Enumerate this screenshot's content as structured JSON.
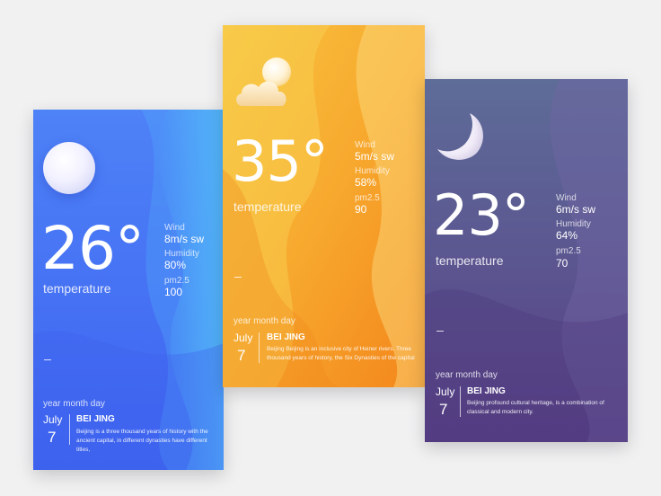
{
  "cards": [
    {
      "id": "blue",
      "colors": {
        "top": "#4f7df6",
        "bottom": "#3f5ef0",
        "accent": "#55c3f8"
      },
      "icon": "sun-icon",
      "temperature": "26°",
      "temperature_label": "temperature",
      "wind_label": "Wind",
      "wind_value": "8m/s sw",
      "humidity_label": "Humidity",
      "humidity_value": "80%",
      "pm_label": "pm2.5",
      "pm_value": "100",
      "date_label": "year month day",
      "month": "July",
      "day": "7",
      "city": "BEI JING",
      "description": "Beijing is a three thousand years of history with the ancient capital, in different dynasties have different titles,"
    },
    {
      "id": "orange",
      "colors": {
        "top": "#f7c13e",
        "bottom": "#f48a1e",
        "accent": "#fde38a"
      },
      "icon": "partly-cloudy-icon",
      "temperature": "35°",
      "temperature_label": "temperature",
      "wind_label": "Wind",
      "wind_value": "5m/s sw",
      "humidity_label": "Humidity",
      "humidity_value": "58%",
      "pm_label": "pm2.5",
      "pm_value": "90",
      "date_label": "year month day",
      "month": "July",
      "day": "7",
      "city": "BEI JING",
      "description": "Beijing Beijing is an inclusive city of Heiner rivers. Three thousand years of history, the Six Dynasties of the capital"
    },
    {
      "id": "purple",
      "colors": {
        "top": "#5e6b97",
        "bottom": "#5a3b82",
        "accent": "#7a63a8"
      },
      "icon": "crescent-moon-icon",
      "temperature": "23°",
      "temperature_label": "temperature",
      "wind_label": "Wind",
      "wind_value": "6m/s sw",
      "humidity_label": "Humidity",
      "humidity_value": "64%",
      "pm_label": "pm2.5",
      "pm_value": "70",
      "date_label": "year month day",
      "month": "July",
      "day": "7",
      "city": "BEI JING",
      "description": "Beijing profound cultural heritage, is a combination of classical and modern city."
    }
  ]
}
